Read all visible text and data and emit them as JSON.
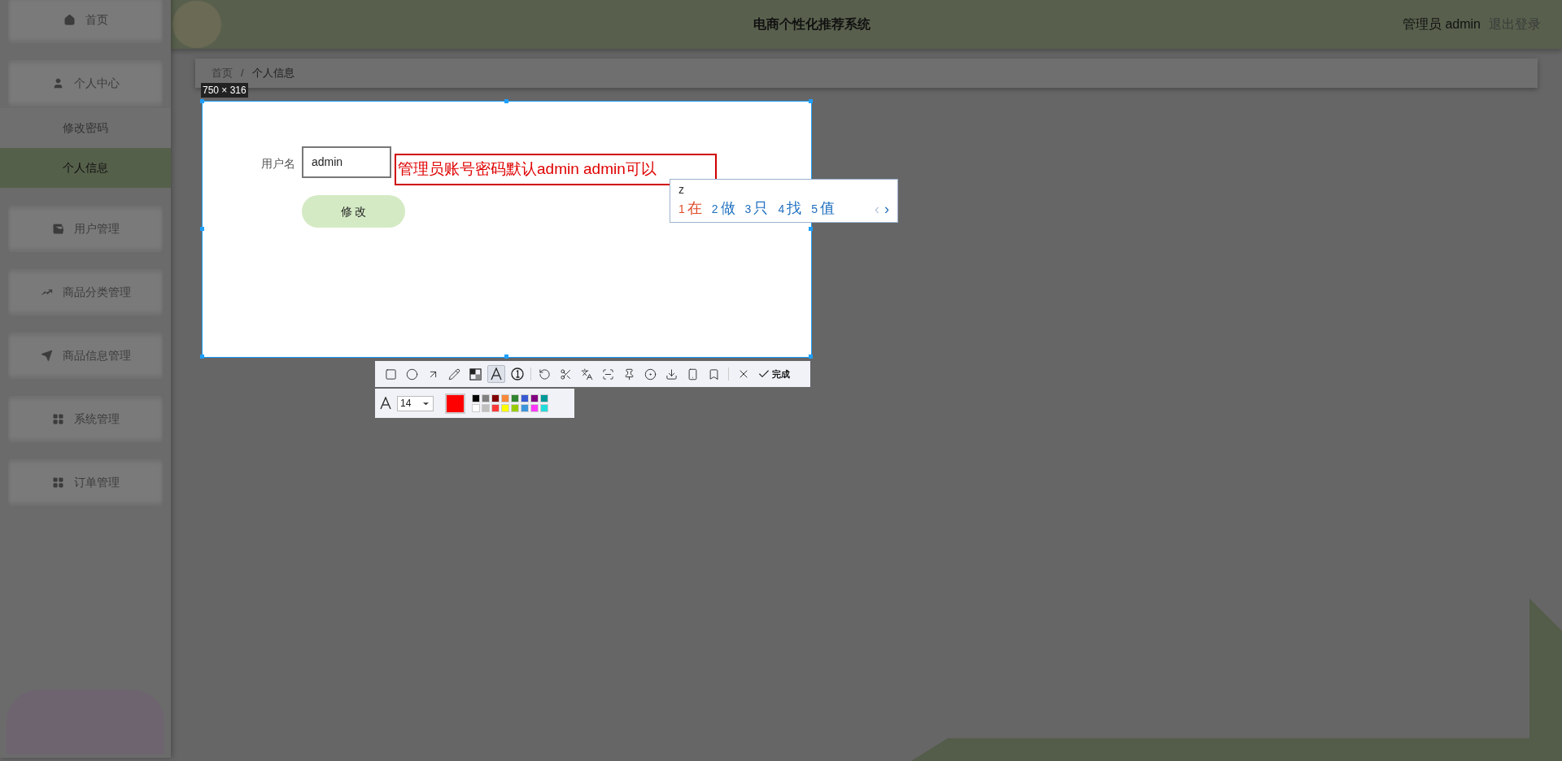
{
  "sidebar": {
    "items": [
      {
        "label": "首页"
      },
      {
        "label": "个人中心",
        "children": [
          {
            "label": "修改密码",
            "selected": false
          },
          {
            "label": "个人信息",
            "selected": true
          }
        ]
      },
      {
        "label": "用户管理"
      },
      {
        "label": "商品分类管理"
      },
      {
        "label": "商品信息管理"
      },
      {
        "label": "系统管理"
      },
      {
        "label": "订单管理"
      }
    ]
  },
  "header": {
    "title": "电商个性化推荐系统",
    "user": "管理员 admin",
    "logout": "退出登录"
  },
  "breadcrumb": {
    "items": [
      "首页",
      "个人信息"
    ],
    "separator": "/"
  },
  "capture": {
    "size_label": "750 × 316",
    "form": {
      "label": "用户名",
      "value": "admin",
      "button": "修 改"
    },
    "annotation": "管理员账号密码默认admin admin可以"
  },
  "ime": {
    "input": "z",
    "candidates": [
      {
        "index": "1",
        "text": "在",
        "selected": true
      },
      {
        "index": "2",
        "text": "做",
        "selected": false
      },
      {
        "index": "3",
        "text": "只",
        "selected": false
      },
      {
        "index": "4",
        "text": "找",
        "selected": false
      },
      {
        "index": "5",
        "text": "值",
        "selected": false
      }
    ],
    "prev": "‹",
    "next": "›"
  },
  "toolbar": {
    "tools": [
      {
        "selected": false
      },
      {
        "selected": false
      },
      {
        "selected": false
      },
      {
        "selected": false
      },
      {
        "selected": false
      },
      {
        "selected": true
      },
      {
        "selected": false
      },
      {
        "selected": false
      },
      {
        "selected": false
      },
      {
        "selected": false
      },
      {
        "selected": false
      },
      {
        "selected": false
      },
      {
        "selected": false
      },
      {
        "selected": false
      },
      {
        "selected": false
      },
      {
        "selected": false
      }
    ],
    "done": "完成"
  },
  "text_options": {
    "font_size": "14",
    "current": {
      "color": "#ff0000"
    },
    "palette": [
      {
        "color": "#000000"
      },
      {
        "color": "#808080"
      },
      {
        "color": "#800000"
      },
      {
        "color": "#f7883a"
      },
      {
        "color": "#308430"
      },
      {
        "color": "#385ad3"
      },
      {
        "color": "#800080"
      },
      {
        "color": "#009999"
      },
      {
        "color": "#ffffff"
      },
      {
        "color": "#c0c0c0"
      },
      {
        "color": "#fb3838"
      },
      {
        "color": "#ffff00"
      },
      {
        "color": "#99cc00"
      },
      {
        "color": "#3d95db"
      },
      {
        "color": "#fb38fb"
      },
      {
        "color": "#22dcdc"
      }
    ]
  }
}
